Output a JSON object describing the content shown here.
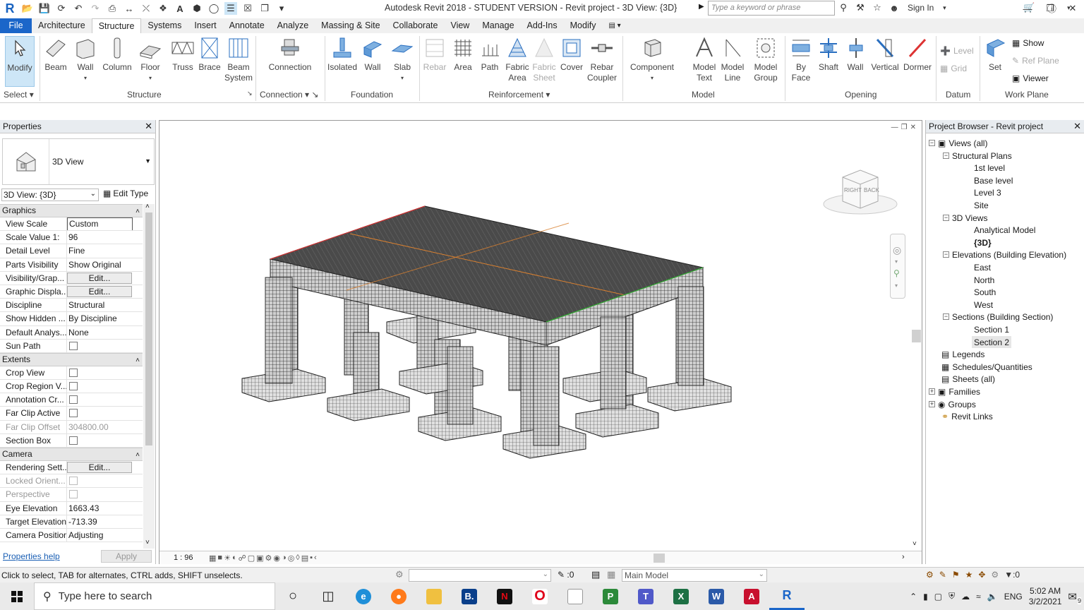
{
  "title_bar": {
    "app_title": "Autodesk Revit 2018 - STUDENT VERSION -     Revit project - 3D View: {3D}",
    "search_placeholder": "Type a keyword or phrase",
    "sign_in": "Sign In"
  },
  "ribbon_tabs": [
    "File",
    "Architecture",
    "Structure",
    "Systems",
    "Insert",
    "Annotate",
    "Analyze",
    "Massing & Site",
    "Collaborate",
    "View",
    "Manage",
    "Add-Ins",
    "Modify"
  ],
  "ribbon": {
    "modify": "Modify",
    "select_label": "Select",
    "structure_tools": [
      "Beam",
      "Wall",
      "Column",
      "Floor",
      "Truss",
      "Brace",
      "Beam System"
    ],
    "structure_label": "Structure",
    "connection_tool": "Connection",
    "connection_label": "Connection",
    "foundation_tools": [
      "Isolated",
      "Wall",
      "Slab"
    ],
    "foundation_label": "Foundation",
    "reinforcement_tools": [
      "Rebar",
      "Area",
      "Path",
      "Fabric Area",
      "Fabric Sheet",
      "Cover",
      "Rebar Coupler"
    ],
    "reinforcement_label": "Reinforcement",
    "model_tools": [
      "Component",
      "Model Text",
      "Model Line",
      "Model Group"
    ],
    "model_label": "Model",
    "opening_tools": [
      "By Face",
      "Shaft",
      "Wall",
      "Vertical",
      "Dormer"
    ],
    "opening_label": "Opening",
    "datum_tools": [
      "Level",
      "Grid"
    ],
    "datum_label": "Datum",
    "workplane_set": "Set",
    "workplane_tools": [
      "Show",
      "Ref  Plane",
      "Viewer"
    ],
    "workplane_label": "Work Plane"
  },
  "properties": {
    "title": "Properties",
    "type_name": "3D View",
    "view_filter": "3D View: {3D}",
    "edit_type": "Edit Type",
    "graphics_label": "Graphics",
    "graphics_rows": [
      {
        "key": "View Scale",
        "value": "Custom"
      },
      {
        "key": "Scale Value    1:",
        "value": "96"
      },
      {
        "key": "Detail Level",
        "value": "Fine"
      },
      {
        "key": "Parts Visibility",
        "value": "Show Original"
      },
      {
        "key": "Visibility/Grap...",
        "value": "Edit..."
      },
      {
        "key": "Graphic Displa...",
        "value": "Edit..."
      },
      {
        "key": "Discipline",
        "value": "Structural"
      },
      {
        "key": "Show Hidden ...",
        "value": "By Discipline"
      },
      {
        "key": "Default Analys...",
        "value": "None"
      },
      {
        "key": "Sun Path",
        "value": ""
      }
    ],
    "extents_label": "Extents",
    "extents_rows": [
      {
        "key": "Crop View",
        "value": ""
      },
      {
        "key": "Crop Region V...",
        "value": ""
      },
      {
        "key": "Annotation Cr...",
        "value": ""
      },
      {
        "key": "Far Clip Active",
        "value": ""
      },
      {
        "key": "Far Clip Offset",
        "value": "304800.00"
      },
      {
        "key": "Section Box",
        "value": ""
      }
    ],
    "camera_label": "Camera",
    "camera_rows": [
      {
        "key": "Rendering Sett...",
        "value": "Edit..."
      },
      {
        "key": "Locked Orient...",
        "value": ""
      },
      {
        "key": "Perspective",
        "value": ""
      },
      {
        "key": "Eye Elevation",
        "value": "1663.43"
      },
      {
        "key": "Target Elevation",
        "value": "-713.39"
      },
      {
        "key": "Camera Position",
        "value": "Adjusting"
      }
    ],
    "help_link": "Properties help",
    "apply": "Apply"
  },
  "viewport": {
    "scale": "1 : 96",
    "viewcube_right": "RIGHT",
    "viewcube_back": "BACK"
  },
  "project_browser": {
    "title": "Project Browser - Revit project",
    "views_all": "Views (all)",
    "structural_plans": "Structural Plans",
    "plans": [
      "1st level",
      "Base level",
      "Level 3",
      "Site"
    ],
    "views_3d": "3D Views",
    "views_3d_items": [
      "Analytical Model",
      "{3D}"
    ],
    "elevations": "Elevations (Building Elevation)",
    "elevation_items": [
      "East",
      "North",
      "South",
      "West"
    ],
    "sections": "Sections (Building Section)",
    "section_items": [
      "Section 1",
      "Section 2"
    ],
    "legends": "Legends",
    "schedules": "Schedules/Quantities",
    "sheets": "Sheets (all)",
    "families": "Families",
    "groups": "Groups",
    "revit_links": "Revit Links"
  },
  "status_bar": {
    "message": "Click to select, TAB for alternates, CTRL adds, SHIFT unselects.",
    "design_option_count": ":0",
    "model": "Main Model",
    "filter_count": ":0"
  },
  "taskbar": {
    "search": "Type here to search",
    "language": "ENG",
    "time": "5:02 AM",
    "date": "3/2/2021",
    "notification_count": "9"
  }
}
